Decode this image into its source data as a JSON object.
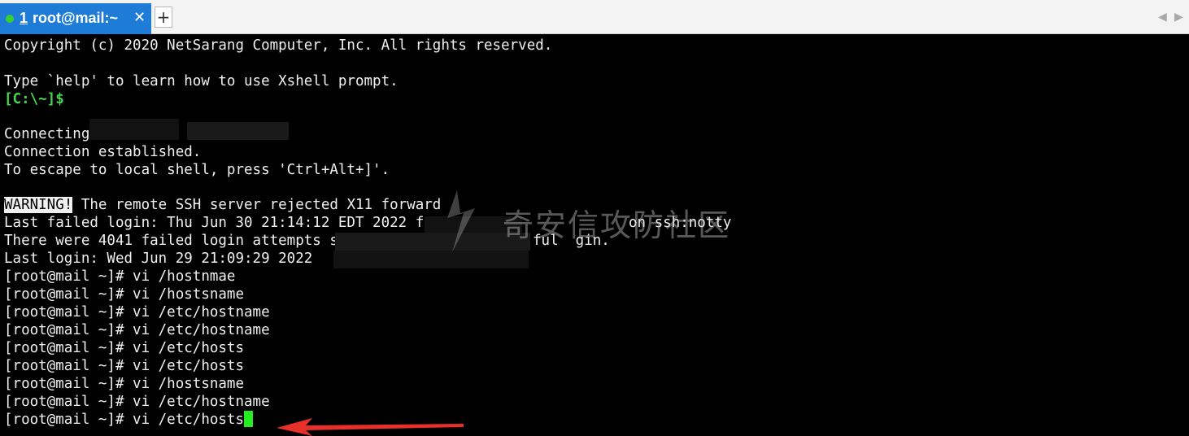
{
  "tab": {
    "number": "1",
    "title": "root@mail:~",
    "close": "✕"
  },
  "new_tab": "+",
  "scroll": {
    "left": "◀",
    "right": "▶"
  },
  "terminal": {
    "copyright": "Copyright (c) 2020 NetSarang Computer, Inc. All rights reserved.",
    "help": "Type `help' to learn how to use Xshell prompt.",
    "local_prompt": "[C:\\~]$",
    "connecting": "Connecting",
    "established": "Connection established.",
    "escape": "To escape to local shell, press 'Ctrl+Alt+]'.",
    "warning_badge": "WARNING!",
    "warning_rest": " The remote SSH server rejected X11 forward",
    "failed_login_a": "Last failed login: Thu Jun 30 21:14:12 EDT 2022 from",
    "failed_login_b": "on ssh:notty",
    "attempts_a": "There were 4041 failed login attempts si",
    "attempts_b": "ful  gin.",
    "last_login": "Last login: Wed Jun 29 21:09:29 2022",
    "history": [
      "[root@mail ~]# vi /hostnmae",
      "[root@mail ~]# vi /hostsname",
      "[root@mail ~]# vi /etc/hostname",
      "[root@mail ~]# vi /etc/hostname",
      "[root@mail ~]# vi /etc/hosts",
      "[root@mail ~]# vi /etc/hosts",
      "[root@mail ~]# vi /hostsname",
      "[root@mail ~]# vi /etc/hostname",
      "[root@mail ~]# vi /etc/hosts"
    ]
  },
  "watermark": "奇安信攻防社区",
  "colors": {
    "tab_active": "#1e7bd6",
    "local_prompt": "#44d64a",
    "cursor": "#22ee22",
    "arrow": "#e8302a"
  }
}
